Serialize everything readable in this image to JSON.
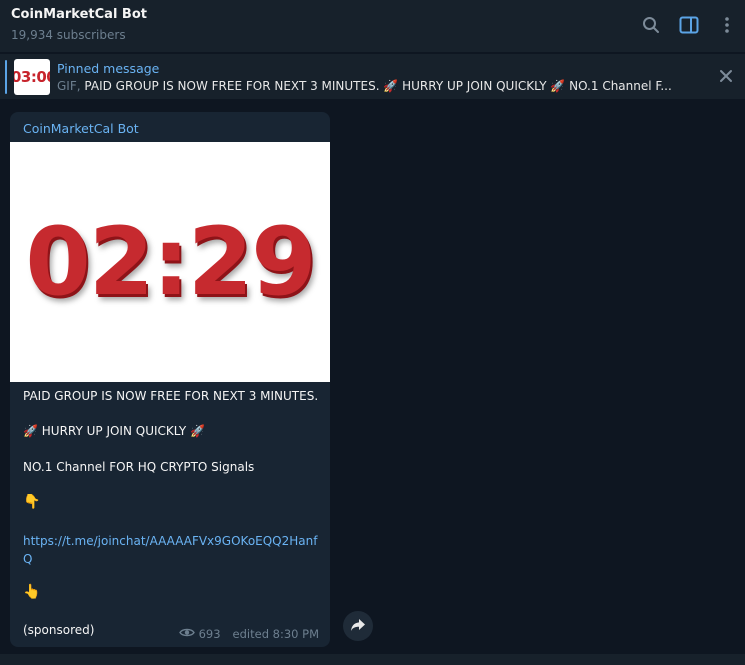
{
  "header": {
    "title": "CoinMarketCal Bot",
    "subscribers": "19,934 subscribers",
    "icons": [
      "search-icon",
      "sidebar-toggle-icon",
      "more-vertical-icon"
    ]
  },
  "pinned": {
    "label": "Pinned message",
    "thumb_text": "03:00",
    "prefix": "GIF,",
    "text": "PAID GROUP IS NOW FREE FOR NEXT 3 MINUTES. 🚀 HURRY UP JOIN QUICKLY 🚀 NO.1 Channel F..."
  },
  "message": {
    "sender": "CoinMarketCal Bot",
    "timer": "02:29",
    "line1": "PAID GROUP IS NOW FREE FOR NEXT 3 MINUTES.",
    "line2": "🚀 HURRY UP JOIN QUICKLY 🚀",
    "line3": "NO.1 Channel FOR HQ CRYPTO Signals",
    "emoji_down": "👇",
    "link": "https://t.me/joinchat/AAAAAFVx9GOKoEQQ2HanfQ",
    "emoji_up": "👆",
    "sponsored": "(sponsored)",
    "views": "693",
    "edited": "edited 8:30 PM"
  },
  "colors": {
    "background": "#0e1621",
    "panel": "#17212b",
    "bubble": "#182533",
    "accent": "#6ab3f3",
    "timer_red": "#c62a2f"
  }
}
